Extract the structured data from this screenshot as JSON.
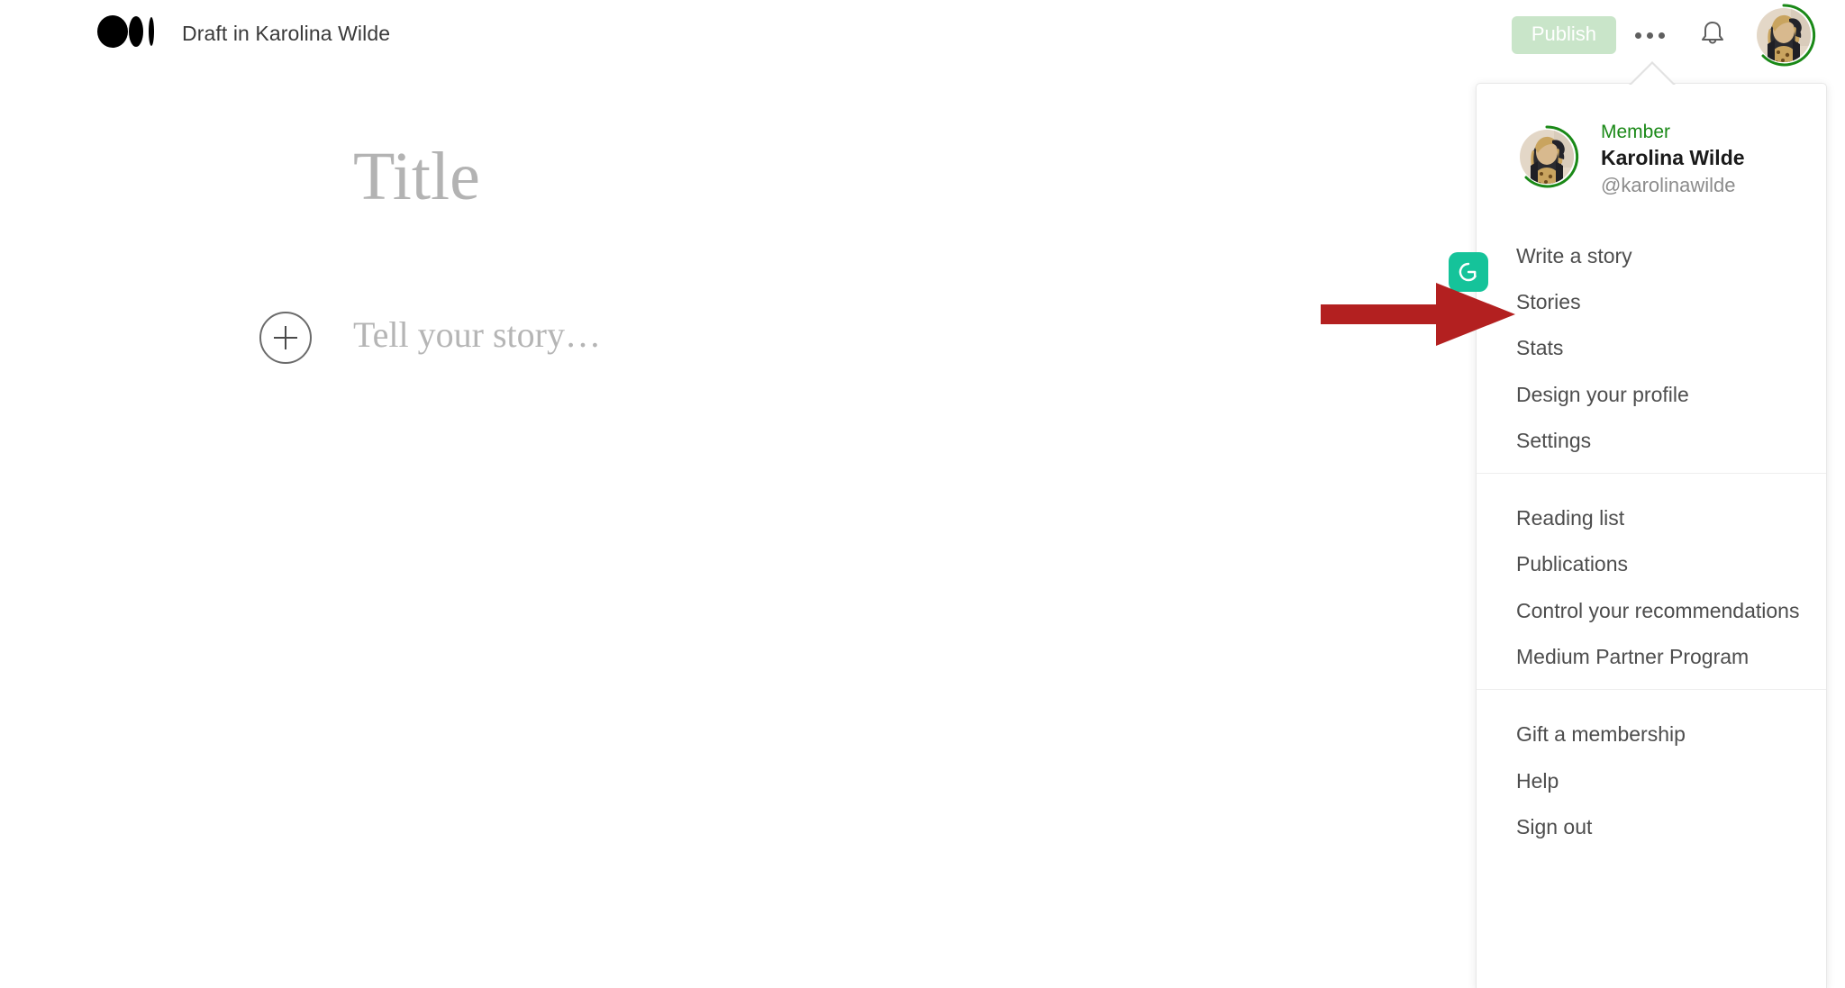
{
  "topbar": {
    "logo_icon": "medium-logo-icon",
    "draft_title": "Draft in Karolina Wilde",
    "publish_label": "Publish",
    "more_icon": "ellipsis-icon",
    "notifications_icon": "bell-icon",
    "avatar_icon": "user-avatar"
  },
  "editor": {
    "title_placeholder": "Title",
    "body_placeholder": "Tell your story…",
    "add_block_icon": "plus-circle-icon"
  },
  "grammarly": {
    "icon": "grammarly-icon",
    "label": "G"
  },
  "annotation": {
    "arrow_icon": "red-arrow-icon",
    "arrow_color": "#b32020",
    "points_to": "Write a story"
  },
  "menu": {
    "profile": {
      "status": "Member",
      "name": "Karolina Wilde",
      "handle": "@karolinawilde"
    },
    "groups": [
      {
        "items": [
          {
            "label": "Write a story"
          },
          {
            "label": "Stories"
          },
          {
            "label": "Stats"
          },
          {
            "label": "Design your profile"
          },
          {
            "label": "Settings"
          }
        ]
      },
      {
        "items": [
          {
            "label": "Reading list"
          },
          {
            "label": "Publications"
          },
          {
            "label": "Control your recommendations"
          },
          {
            "label": "Medium Partner Program"
          }
        ]
      },
      {
        "items": [
          {
            "label": "Gift a membership"
          },
          {
            "label": "Help"
          },
          {
            "label": "Sign out"
          }
        ]
      }
    ]
  },
  "colors": {
    "member_green": "#1a8917",
    "publish_bg": "#c9e5c9",
    "grammarly_green": "#15c39a",
    "arrow_red": "#b32020",
    "avatar_ring": "#1a8917"
  }
}
